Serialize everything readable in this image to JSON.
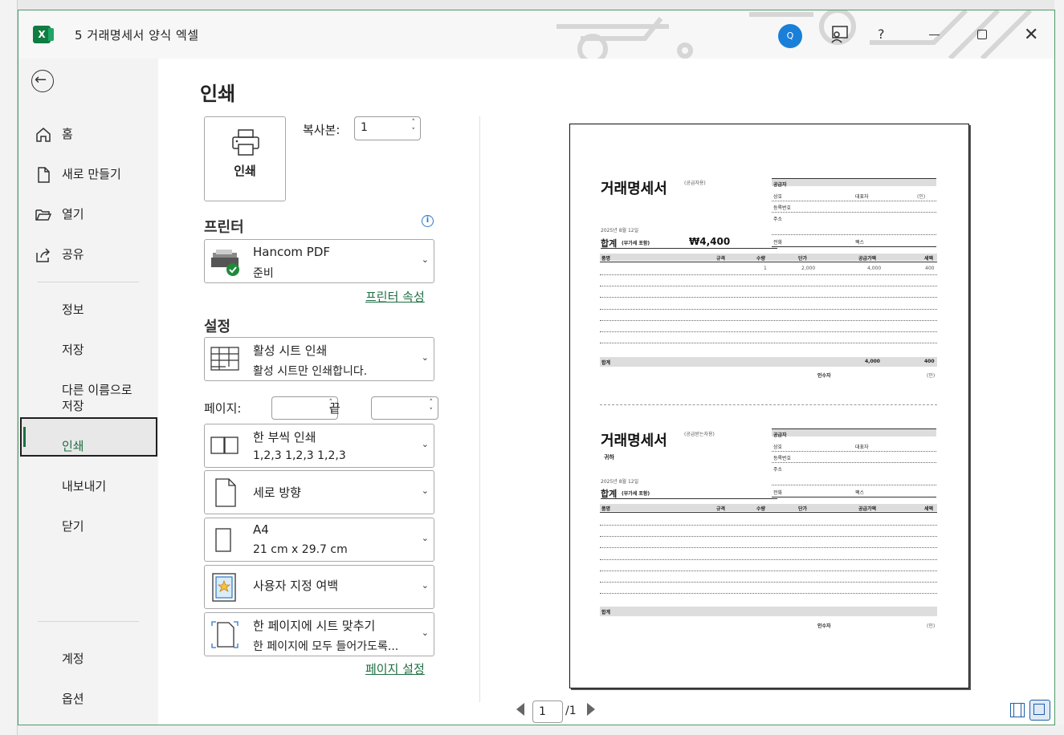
{
  "window": {
    "title": "5 거래명세서 양식 엑셀",
    "user_initial": "Q",
    "help": "?"
  },
  "nav": {
    "items": [
      {
        "label": "홈",
        "icon": "home-icon"
      },
      {
        "label": "새로 만들기",
        "icon": "new-file-icon"
      },
      {
        "label": "열기",
        "icon": "folder-open-icon"
      },
      {
        "label": "공유",
        "icon": "share-icon"
      },
      {
        "label": "정보"
      },
      {
        "label": "저장"
      },
      {
        "label": "다른 이름으로",
        "label2": "저장"
      },
      {
        "label": "인쇄",
        "active": true
      },
      {
        "label": "내보내기"
      },
      {
        "label": "닫기"
      },
      {
        "label": "계정"
      },
      {
        "label": "옵션"
      }
    ]
  },
  "print": {
    "title": "인쇄",
    "print_button": "인쇄",
    "copies_label": "복사본:",
    "copies_value": "1",
    "printer_header": "프린터",
    "printer_name": "Hancom PDF",
    "printer_status": "준비",
    "printer_props_link": "프린터 속성",
    "settings_header": "설정",
    "what": {
      "l1": "활성 시트 인쇄",
      "l2": "활성 시트만 인쇄합니다."
    },
    "pages_label": "페이지:",
    "to_label": "끝",
    "collate": {
      "l1": "한 부씩 인쇄",
      "l2": "1,2,3    1,2,3    1,2,3"
    },
    "orientation": {
      "l1": "세로 방향"
    },
    "paper": {
      "l1": "A4",
      "l2": "21 cm x 29.7 cm"
    },
    "margins": {
      "l1": "사용자 지정 여백"
    },
    "scaling": {
      "l1": "한 페이지에 시트 맞추기",
      "l2": "한 페이지에 모두 들어가도록..."
    },
    "page_setup_link": "페이지 설정"
  },
  "preview": {
    "page_current": "1",
    "page_total": "/1",
    "doc": {
      "title": "거래명세서",
      "copy1_tag": "(공급자용)",
      "copy2_tag": "(공급받는자용)",
      "date": "2025년 8월 12일",
      "total_label": "합계",
      "vat_note": "(부가세 포함)",
      "total_amount": "₩4,400",
      "recipient": "귀하",
      "supplier": "공급자",
      "company": "상호",
      "ceo": "대표자",
      "seal": "(인)",
      "reg_no": "등록번호",
      "address": "주소",
      "phone": "전화",
      "fax": "팩스",
      "cols": [
        "품명",
        "규격",
        "수량",
        "단가",
        "공급가액",
        "세액"
      ],
      "row1": [
        "1",
        "2,000",
        "4,000",
        "400"
      ],
      "sum_label": "합계",
      "sum_supply": "4,000",
      "sum_tax": "400",
      "receiver": "인수자"
    }
  }
}
